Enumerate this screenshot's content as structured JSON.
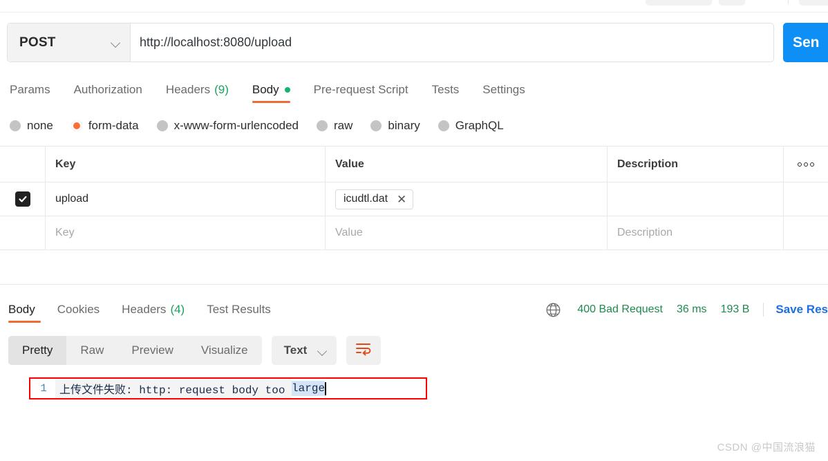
{
  "request": {
    "method": "POST",
    "url": "http://localhost:8080/upload",
    "send_label": "Sen",
    "tabs": [
      {
        "label": "Params",
        "active": false
      },
      {
        "label": "Authorization",
        "active": false
      },
      {
        "label": "Headers",
        "count": "(9)",
        "active": false
      },
      {
        "label": "Body",
        "active": true,
        "dot": true
      },
      {
        "label": "Pre-request Script",
        "active": false
      },
      {
        "label": "Tests",
        "active": false
      },
      {
        "label": "Settings",
        "active": false
      }
    ],
    "body_types": [
      {
        "label": "none",
        "selected": false
      },
      {
        "label": "form-data",
        "selected": true
      },
      {
        "label": "x-www-form-urlencoded",
        "selected": false
      },
      {
        "label": "raw",
        "selected": false
      },
      {
        "label": "binary",
        "selected": false
      },
      {
        "label": "GraphQL",
        "selected": false
      }
    ],
    "table": {
      "headers": [
        "Key",
        "Value",
        "Description"
      ],
      "rows": [
        {
          "checked": true,
          "key": "upload",
          "value_file": "icudtl.dat",
          "description": ""
        }
      ],
      "placeholder_row": {
        "key": "Key",
        "value": "Value",
        "description": "Description"
      }
    }
  },
  "response": {
    "tabs": [
      {
        "label": "Body",
        "active": true
      },
      {
        "label": "Cookies",
        "active": false
      },
      {
        "label": "Headers",
        "count": "(4)",
        "active": false
      },
      {
        "label": "Test Results",
        "active": false
      }
    ],
    "status": "400 Bad Request",
    "time": "36 ms",
    "size": "193 B",
    "save_label": "Save Res",
    "view_modes": [
      {
        "label": "Pretty",
        "active": true
      },
      {
        "label": "Raw",
        "active": false
      },
      {
        "label": "Preview",
        "active": false
      },
      {
        "label": "Visualize",
        "active": false
      }
    ],
    "format": "Text",
    "body": {
      "line_number": "1",
      "text_plain": "上传文件失败: http: request body too ",
      "text_selected": "large"
    }
  },
  "watermark": "CSDN @中国流浪猫",
  "colors": {
    "accent": "#ff6c37",
    "send": "#0d8ff5",
    "status": "#1d8a4e",
    "link": "#1d6fe0",
    "annotation": "#ff0000"
  }
}
